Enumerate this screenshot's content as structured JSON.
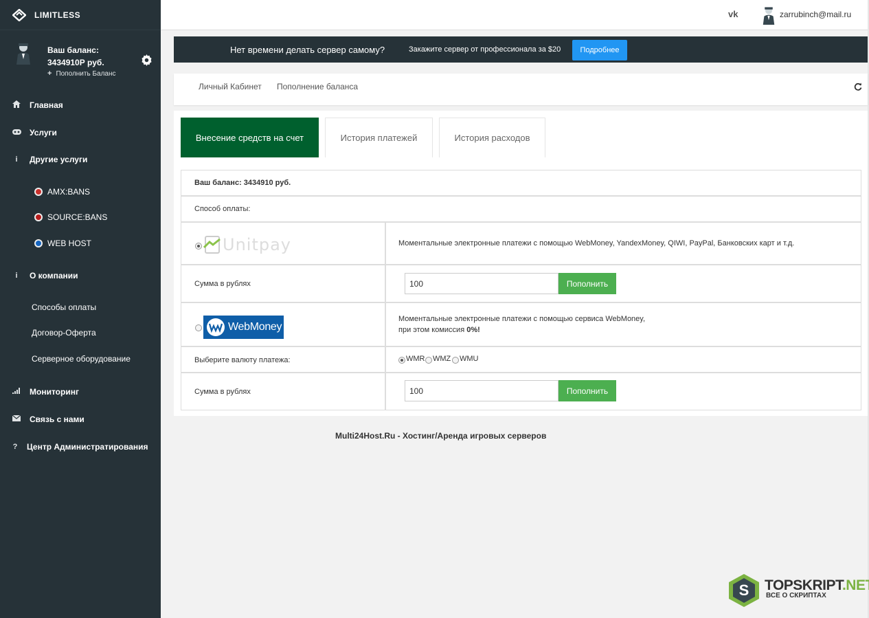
{
  "brand": {
    "name": "LIMITLESS"
  },
  "sidebar": {
    "balance_label": "Ваш баланс: 3434910Р руб.",
    "topup": "Пополнить Баланс",
    "nav": [
      {
        "label": "Главная",
        "icon": "home-icon"
      },
      {
        "label": "Услуги",
        "icon": "gamepad-icon"
      },
      {
        "label": "Другие услуги",
        "icon": "info-icon"
      },
      {
        "label": "О компании",
        "icon": "info-icon"
      },
      {
        "label": "Мониторинг",
        "icon": "signal-icon"
      },
      {
        "label": "Связь с нами",
        "icon": "envelope-icon"
      },
      {
        "label": "Центр Администратирования",
        "icon": "question-icon"
      }
    ],
    "other_services": [
      "AMX:BANS",
      "SOURCE:BANS",
      "WEB HOST"
    ],
    "about": [
      "Способы оплаты",
      "Договор-Оферта",
      "Серверное оборудование"
    ]
  },
  "header": {
    "email": "zarrubinch@mail.ru",
    "social": "vk"
  },
  "promo": {
    "question": "Нет времени делать сервер самому?",
    "text": "Закажите сервер от профессионала за $20",
    "button": "Подробнее"
  },
  "breadcrumb": [
    "Личный Кабинет",
    "Пополнение баланса"
  ],
  "tabs": [
    "Внесение средств на счет",
    "История платежей",
    "История расходов"
  ],
  "form": {
    "balance": "Ваш баланс: 3434910 руб.",
    "method_label": "Способ оплаты:",
    "unitpay": {
      "logo": "Unitpay",
      "desc": "Моментальные электронные платежи с помощью WebMoney, YandexMoney, QIWI, PayPal, Банковских карт и т.д.",
      "sum_label": "Сумма в рублях",
      "amount": "100",
      "button": "Пополнить"
    },
    "webmoney": {
      "logo": "WebMoney",
      "desc1": "Моментальные электронные платежи с помощью сервиса WebMoney,",
      "desc2_prefix": "при этом комиссия ",
      "desc2_bold": "0%!",
      "currency_label": "Выберите валюту платежа:",
      "currencies": [
        "WMR",
        "WMZ",
        "WMU"
      ],
      "sum_label": "Сумма в рублях",
      "amount": "100",
      "button": "Пополнить"
    }
  },
  "footer": "Multi24Host.Ru - Хостинг/Аренда игровых серверов",
  "watermark": {
    "title_a": "TOPSKRIPT",
    "title_b": ".NET",
    "sub": "ВСЕ О СКРИПТАХ",
    "badge_letter": "S"
  },
  "colors": {
    "sidebar": "#263238",
    "active_tab": "#00602e",
    "primary_button": "#2196f3",
    "success_button": "#4caf50"
  }
}
